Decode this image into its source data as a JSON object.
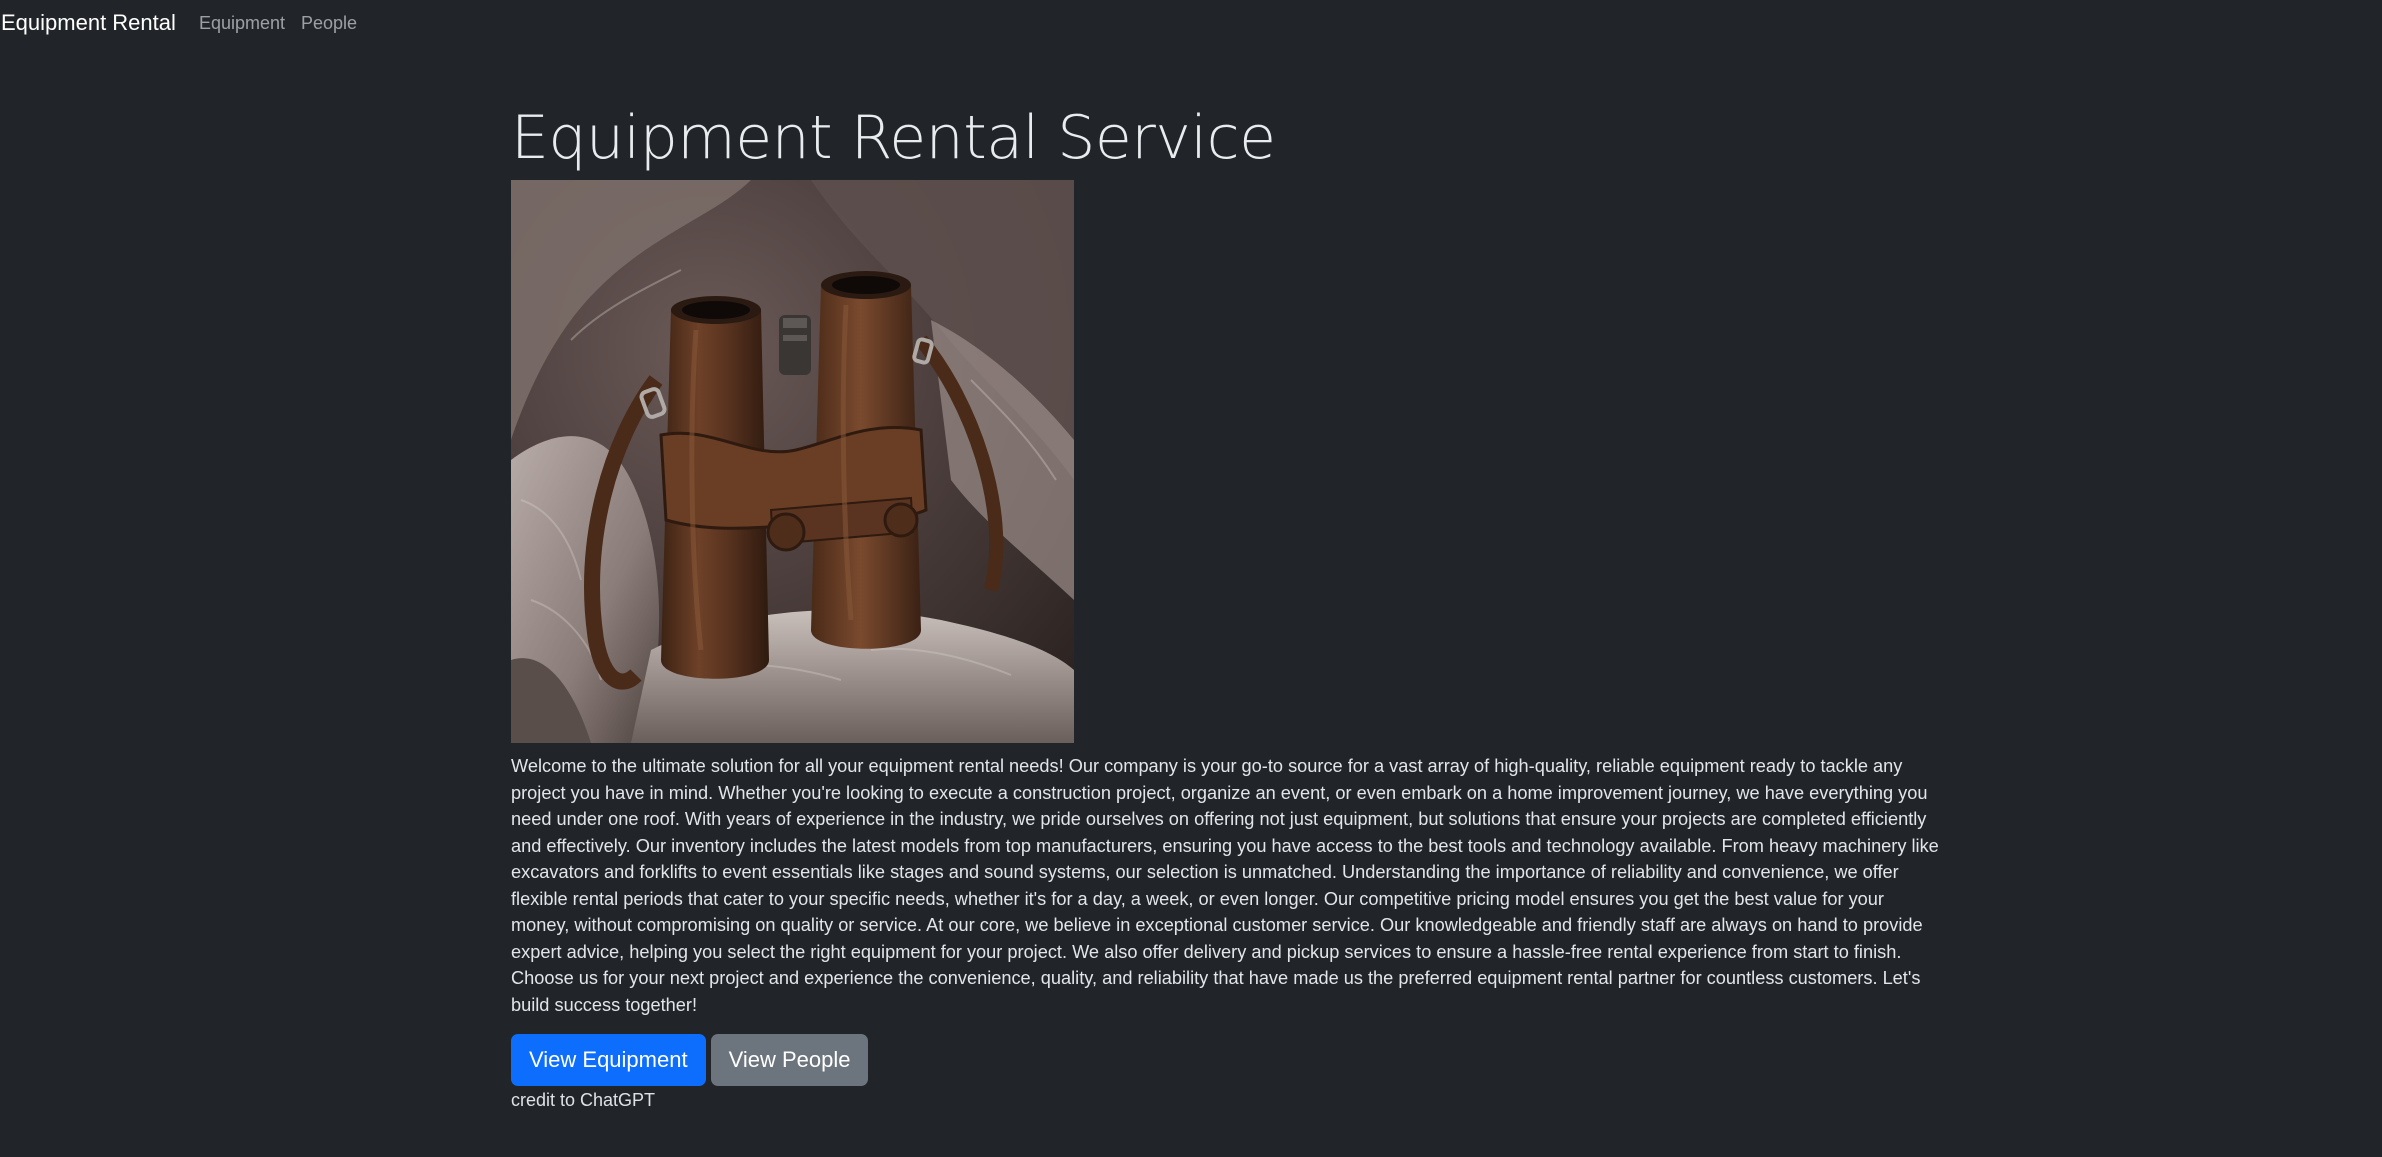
{
  "navbar": {
    "brand": "Equipment Rental",
    "links": [
      {
        "label": "Equipment"
      },
      {
        "label": "People"
      }
    ]
  },
  "main": {
    "title": "Equipment Rental Service",
    "hero_image": {
      "subject": "binoculars-in-leather-case",
      "colors": {
        "leather": "#5a3420",
        "rock": "#a89a96",
        "shadow": "#2e2622"
      }
    },
    "intro": "Welcome to the ultimate solution for all your equipment rental needs! Our company is your go-to source for a vast array of high-quality, reliable equipment ready to tackle any project you have in mind. Whether you're looking to execute a construction project, organize an event, or even embark on a home improvement journey, we have everything you need under one roof. With years of experience in the industry, we pride ourselves on offering not just equipment, but solutions that ensure your projects are completed efficiently and effectively. Our inventory includes the latest models from top manufacturers, ensuring you have access to the best tools and technology available. From heavy machinery like excavators and forklifts to event essentials like stages and sound systems, our selection is unmatched. Understanding the importance of reliability and convenience, we offer flexible rental periods that cater to your specific needs, whether it's for a day, a week, or even longer. Our competitive pricing model ensures you get the best value for your money, without compromising on quality or service. At our core, we believe in exceptional customer service. Our knowledgeable and friendly staff are always on hand to provide expert advice, helping you select the right equipment for your project. We also offer delivery and pickup services to ensure a hassle-free rental experience from start to finish. Choose us for your next project and experience the convenience, quality, and reliability that have made us the preferred equipment rental partner for countless customers. Let's build success together!",
    "buttons": {
      "view_equipment": "View Equipment",
      "view_people": "View People"
    },
    "credit": "credit to ChatGPT"
  },
  "colors": {
    "background": "#212529",
    "primary": "#0d6efd",
    "secondary": "#6c757d"
  }
}
